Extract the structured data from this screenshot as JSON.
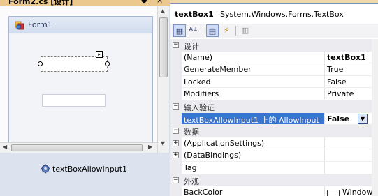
{
  "designer": {
    "tab_title": "Form2.cs [设计]",
    "pin_glyph": "◆",
    "close_glyph": "×",
    "form": {
      "title": "Form1"
    },
    "component_tray": {
      "item_label": "textBoxAllowInput1"
    }
  },
  "properties": {
    "object": {
      "name": "textBox1",
      "type": "System.Windows.Forms.TextBox"
    },
    "toolbar": {
      "categorized": "▦",
      "alphabetical": "A↓",
      "properties": "▤",
      "events": "⚡",
      "pages": "▥"
    },
    "rows": [
      {
        "kind": "category",
        "label": "设计",
        "expander": "⊟"
      },
      {
        "kind": "prop",
        "name": "(Name)",
        "value": "textBox1",
        "bold": true
      },
      {
        "kind": "prop",
        "name": "GenerateMember",
        "value": "True"
      },
      {
        "kind": "prop",
        "name": "Locked",
        "value": "False"
      },
      {
        "kind": "prop",
        "name": "Modifiers",
        "value": "Private"
      },
      {
        "kind": "category",
        "label": "输入验证",
        "expander": "⊟"
      },
      {
        "kind": "prop",
        "name": "textBoxAllowInput1 上的 AllowInput",
        "value": "False",
        "bold": true,
        "selected": true
      },
      {
        "kind": "category",
        "label": "数据",
        "expander": "⊟"
      },
      {
        "kind": "prop",
        "name": "(ApplicationSettings)",
        "value": "",
        "expander": "⊞"
      },
      {
        "kind": "prop",
        "name": "(DataBindings)",
        "value": "",
        "expander": "⊞"
      },
      {
        "kind": "prop",
        "name": "Tag",
        "value": ""
      },
      {
        "kind": "category",
        "label": "外观",
        "expander": "⊟"
      },
      {
        "kind": "prop",
        "name": "BackColor",
        "value": "Window",
        "swatch": "#ffffff"
      }
    ]
  },
  "colors": {
    "selection": "#3874d0",
    "tab_active": "#ebc88e",
    "category_bg": "#ececf0"
  }
}
